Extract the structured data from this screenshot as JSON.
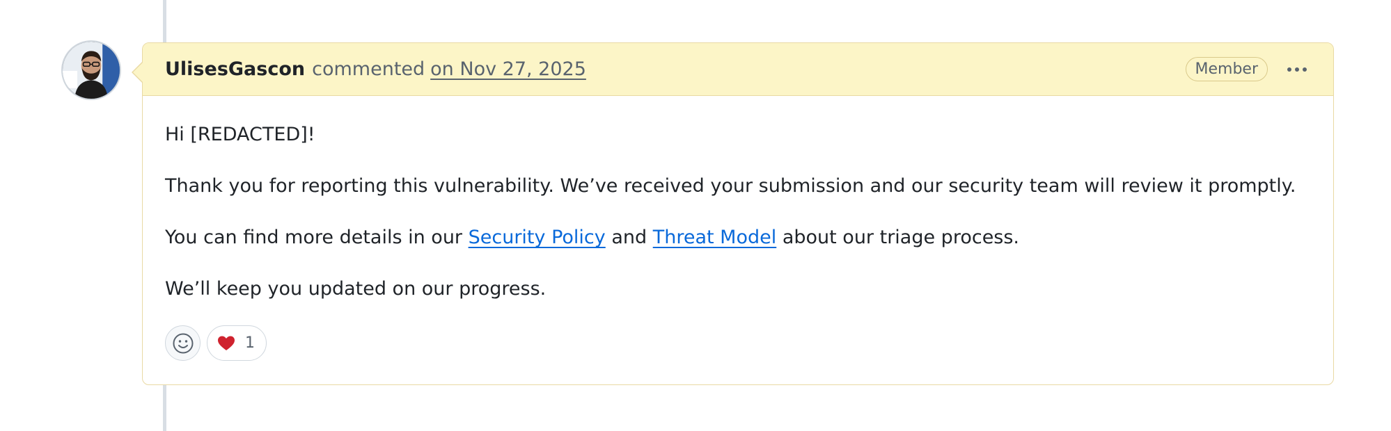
{
  "comment": {
    "author": "UlisesGascon",
    "action": "commented",
    "timestamp": "on Nov 27, 2025",
    "badge": "Member",
    "menu_icon": "kebab-horizontal-icon",
    "body": {
      "greeting": "Hi [REDACTED]!",
      "paragraph_1": "Thank you for reporting this vulnerability. We’ve received your submission and our security team will review it promptly.",
      "paragraph_2_prefix": "You can find more details in our ",
      "link_security_policy": "Security Policy",
      "paragraph_2_middle": " and ",
      "link_threat_model": "Threat Model",
      "paragraph_2_suffix": " about our triage process.",
      "paragraph_3": "We’ll keep you updated on our progress."
    },
    "reactions": {
      "add_icon": "smiley-icon",
      "items": [
        {
          "emoji": "❤️",
          "icon": "heart-icon",
          "count": "1"
        }
      ]
    }
  },
  "colors": {
    "header_bg": "#fcf5c7",
    "border": "#e9d9a3",
    "link": "#0969da",
    "muted": "#59636e",
    "heart": "#cf222e"
  }
}
